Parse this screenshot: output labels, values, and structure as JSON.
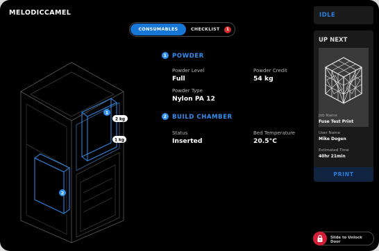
{
  "app": {
    "brand": "MELODICCAMEL"
  },
  "tabs": [
    {
      "label": "CONSUMABLES",
      "active": true
    },
    {
      "label": "CHECKLIST",
      "badge": "1"
    }
  ],
  "sections": [
    {
      "number": "1",
      "title": "POWDER",
      "fields": [
        {
          "label": "Powder Level",
          "value": "Full"
        },
        {
          "label": "Powder Credit",
          "value": "54 kg"
        },
        {
          "label": "Powder Type",
          "value": "Nylon PA 12"
        }
      ]
    },
    {
      "number": "2",
      "title": "BUILD CHAMBER",
      "fields": [
        {
          "label": "Status",
          "value": "Inserted"
        },
        {
          "label": "Bed Temperature",
          "value": "20.5°C"
        }
      ]
    }
  ],
  "diagram": {
    "marker1": "1",
    "marker2": "2",
    "tag_a": "2 kg",
    "tag_b": "1 kg"
  },
  "status": {
    "label": "IDLE"
  },
  "up_next": {
    "title": "UP NEXT",
    "job_name_label": "Job Name",
    "job_name": "Fuse Test Print",
    "user_name_label": "User Name",
    "user_name": "Mike Dogen",
    "time_label": "Estimated Time",
    "time": "40hr 21min",
    "print_label": "PRINT"
  },
  "unlock": {
    "label": "Slide to Unlock Door"
  },
  "colors": {
    "accent": "#2f8ef0",
    "alert": "#d31f35",
    "background": "#000000"
  }
}
